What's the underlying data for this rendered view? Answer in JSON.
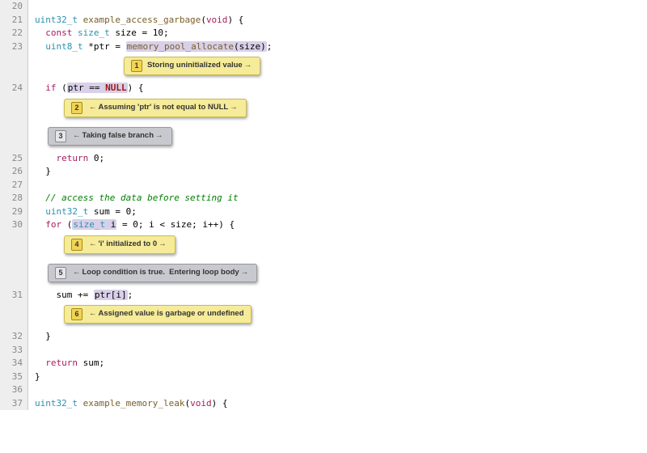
{
  "lines": {
    "l20": {
      "num": "20",
      "code": ""
    },
    "l21": {
      "num": "21",
      "t_uint32": "uint32_t",
      "fn": "example_access_garbage",
      "t_void": "void"
    },
    "l22": {
      "num": "22",
      "kw_const": "const",
      "t_size": "size_t",
      "rest": " size = 10;"
    },
    "l23": {
      "num": "23",
      "t_u8": "uint8_t",
      "mid": " *ptr = ",
      "fn": "memory_pool_allocate",
      "tail": "(size)",
      "semi": ";"
    },
    "l24": {
      "num": "24",
      "kw_if": "if",
      "open": " (",
      "hl": "ptr == ",
      "null": "NULL",
      "close": ") {"
    },
    "l25": {
      "num": "25",
      "kw_ret": "return",
      "val": " 0;"
    },
    "l26": {
      "num": "26",
      "brace": "}"
    },
    "l27": {
      "num": "27",
      "code": ""
    },
    "l28": {
      "num": "28",
      "cmt": "// access the data before setting it"
    },
    "l29": {
      "num": "29",
      "t_uint32": "uint32_t",
      "rest": " sum = 0;"
    },
    "l30": {
      "num": "30",
      "kw_for": "for",
      "open": " (",
      "hl1": "size_t",
      "hl2": " i",
      "rest": " = 0; i < size; i++) {"
    },
    "l31": {
      "num": "31",
      "pre": "sum += ",
      "hl": "ptr[i]",
      "semi": ";"
    },
    "l32": {
      "num": "32",
      "brace": "}"
    },
    "l33": {
      "num": "33",
      "code": ""
    },
    "l34": {
      "num": "34",
      "kw_ret": "return",
      "val": " sum;"
    },
    "l35": {
      "num": "35",
      "brace": "}"
    },
    "l36": {
      "num": "36",
      "code": ""
    },
    "l37": {
      "num": "37",
      "t_uint32": "uint32_t",
      "fn": "example_memory_leak",
      "t_void": "void"
    }
  },
  "callouts": {
    "c1": {
      "num": "1",
      "text": "Storing uninitialized value",
      "rarrow": "→"
    },
    "c2": {
      "num": "2",
      "larrow": "←",
      "text": "Assuming 'ptr' is not equal to NULL",
      "rarrow": "→"
    },
    "c3": {
      "num": "3",
      "larrow": "←",
      "text": "Taking false branch",
      "rarrow": "→"
    },
    "c4": {
      "num": "4",
      "larrow": "←",
      "text": "'i' initialized to 0",
      "rarrow": "→"
    },
    "c5": {
      "num": "5",
      "larrow": "←",
      "text": "Loop condition is true.  Entering loop body",
      "rarrow": "→"
    },
    "c6": {
      "num": "6",
      "larrow": "←",
      "text": "Assigned value is garbage or undefined"
    }
  }
}
